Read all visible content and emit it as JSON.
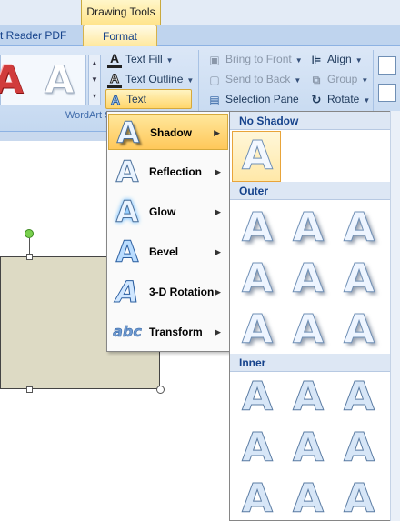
{
  "ribbon": {
    "context_tab_group": "Drawing Tools",
    "tabs": [
      {
        "label": "t Reader PDF"
      },
      {
        "label": "Format"
      }
    ],
    "wordart_group_label": "WordArt Styles",
    "commands": {
      "text_fill": "Text Fill",
      "text_outline": "Text Outline",
      "text_effects": "Text Effects",
      "bring_to_front": "Bring to Front",
      "send_to_back": "Send to Back",
      "selection_pane": "Selection Pane",
      "align": "Align",
      "group": "Group",
      "rotate": "Rotate"
    }
  },
  "text_effects_menu": {
    "items": [
      {
        "label": "Shadow",
        "icon": "shadow-a-icon"
      },
      {
        "label": "Reflection",
        "icon": "reflection-a-icon"
      },
      {
        "label": "Glow",
        "icon": "glow-a-icon"
      },
      {
        "label": "Bevel",
        "icon": "bevel-a-icon"
      },
      {
        "label": "3-D Rotation",
        "icon": "3d-rotation-a-icon"
      },
      {
        "label": "Transform",
        "icon": "transform-abc-icon"
      }
    ]
  },
  "shadow_gallery": {
    "no_shadow_label": "No Shadow",
    "outer_label": "Outer",
    "inner_label": "Inner",
    "letter": "A"
  },
  "colors": {
    "accent": "#ffd66b",
    "ribbon_bg": "#dbe7f7",
    "shape_fill": "#dddac4"
  }
}
